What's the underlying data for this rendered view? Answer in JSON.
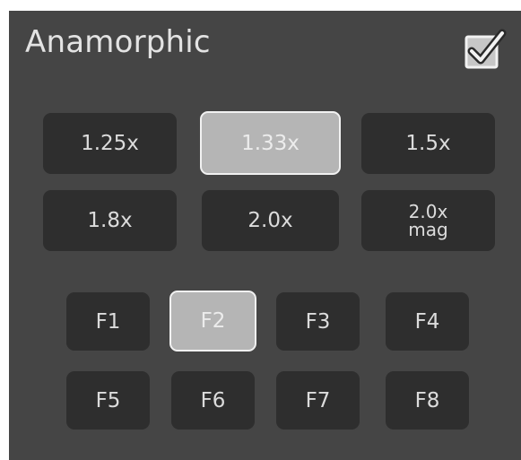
{
  "header": {
    "title": "Anamorphic",
    "toggle_icon": "checkbox-checked-icon",
    "toggle_checked": true
  },
  "lens": {
    "options": [
      {
        "label": "1.25x",
        "selected": false
      },
      {
        "label": "1.33x",
        "selected": true
      },
      {
        "label": "1.5x",
        "selected": false
      },
      {
        "label": "1.8x",
        "selected": false
      },
      {
        "label": "2.0x",
        "selected": false
      },
      {
        "label_line1": "2.0x",
        "label_line2": "mag",
        "selected": false
      }
    ]
  },
  "filters": {
    "options": [
      {
        "label": "F1",
        "selected": false
      },
      {
        "label": "F2",
        "selected": true
      },
      {
        "label": "F3",
        "selected": false
      },
      {
        "label": "F4",
        "selected": false
      },
      {
        "label": "F5",
        "selected": false
      },
      {
        "label": "F6",
        "selected": false
      },
      {
        "label": "F7",
        "selected": false
      },
      {
        "label": "F8",
        "selected": false
      }
    ]
  },
  "colors": {
    "panel_bg": "#454545",
    "button_bg": "#2e2e2e",
    "selected_bg": "#b5b5b5",
    "text": "#dcdcdc"
  }
}
